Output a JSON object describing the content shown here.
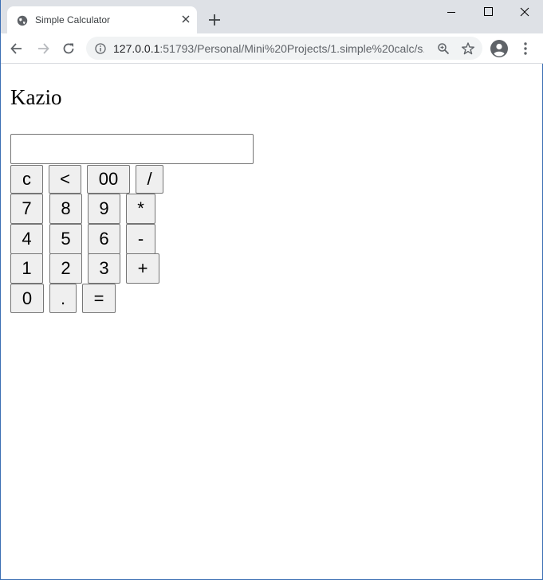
{
  "browser": {
    "tab_title": "Simple Calculator",
    "url_host": "127.0.0.1",
    "url_rest": ":51793/Personal/Mini%20Projects/1.simple%20calc/s...",
    "icons": {
      "favicon": "globe-icon",
      "tab_close": "close-icon",
      "new_tab": "plus-icon",
      "back": "back-arrow-icon",
      "forward": "forward-arrow-icon",
      "reload": "reload-icon",
      "info": "info-icon",
      "zoom": "zoom-icon",
      "bookmark": "star-icon",
      "profile": "account-icon",
      "menu": "more-vertical-icon"
    }
  },
  "page": {
    "heading": "Kazio",
    "display": {
      "value": "",
      "placeholder": ""
    },
    "keys": {
      "clear": "c",
      "backspace": "<",
      "double_zero": "00",
      "divide": "/",
      "seven": "7",
      "eight": "8",
      "nine": "9",
      "multiply": "*",
      "four": "4",
      "five": "5",
      "six": "6",
      "subtract": "-",
      "one": "1",
      "two": "2",
      "three": "3",
      "add": "+",
      "zero": "0",
      "decimal": ".",
      "equals": "="
    }
  },
  "colors": {
    "titlebar_bg": "#dee1e6",
    "omnibox_bg": "#f1f3f4",
    "button_bg": "#efefef",
    "button_border": "#767676",
    "window_border": "#3c6fb4"
  }
}
